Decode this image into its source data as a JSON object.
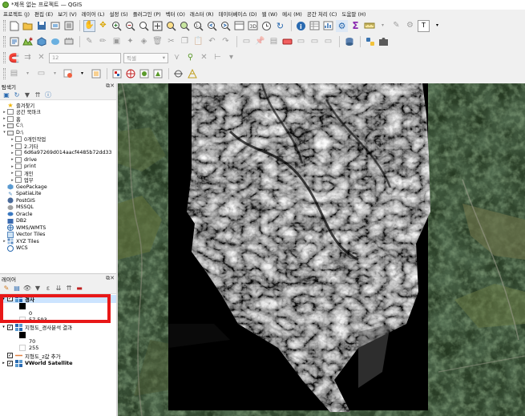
{
  "window": {
    "title": "*제목 없는 프로젝트 — QGIS"
  },
  "menu": [
    "프로젝트 (J)",
    "편집 (E)",
    "보기 (V)",
    "레이어 (L)",
    "설정 (S)",
    "플러그인 (P)",
    "벡터 (O)",
    "래스터 (R)",
    "데이터베이스 (D)",
    "웹 (W)",
    "메시 (M)",
    "공간 처리 (C)",
    "도움말 (H)"
  ],
  "toolbar_digitize": {
    "size_value": "12",
    "unit_value": "픽셀"
  },
  "browser_panel": {
    "title": "탐색기",
    "items": [
      {
        "label": "즐겨찾기",
        "icon": "star-icon",
        "indent": 0,
        "arrow": ""
      },
      {
        "label": "공간 북마크",
        "icon": "bookmark-icon",
        "indent": 0,
        "arrow": "▸"
      },
      {
        "label": "홈",
        "icon": "home-folder-icon",
        "indent": 0,
        "arrow": "▸"
      },
      {
        "label": "C:\\",
        "icon": "drive-icon",
        "indent": 0,
        "arrow": "▸"
      },
      {
        "label": "D:\\",
        "icon": "drive-icon",
        "indent": 0,
        "arrow": "▾"
      },
      {
        "label": "0개인작업",
        "icon": "folder-icon",
        "indent": 1,
        "arrow": "▸"
      },
      {
        "label": "2.기타",
        "icon": "folder-icon",
        "indent": 1,
        "arrow": "▸"
      },
      {
        "label": "6d6a97269d014aacf4485b72dd33",
        "icon": "folder-icon",
        "indent": 1,
        "arrow": "▸"
      },
      {
        "label": "drive",
        "icon": "folder-icon",
        "indent": 1,
        "arrow": "▸"
      },
      {
        "label": "print",
        "icon": "folder-icon",
        "indent": 1,
        "arrow": "▸"
      },
      {
        "label": "개인",
        "icon": "folder-icon",
        "indent": 1,
        "arrow": "▸"
      },
      {
        "label": "업무",
        "icon": "folder-icon",
        "indent": 1,
        "arrow": "▸"
      },
      {
        "label": "GeoPackage",
        "icon": "geopackage-icon",
        "indent": 0,
        "arrow": ""
      },
      {
        "label": "SpatiaLite",
        "icon": "spatialite-icon",
        "indent": 0,
        "arrow": ""
      },
      {
        "label": "PostGIS",
        "icon": "postgis-icon",
        "indent": 0,
        "arrow": ""
      },
      {
        "label": "MSSQL",
        "icon": "mssql-icon",
        "indent": 0,
        "arrow": ""
      },
      {
        "label": "Oracle",
        "icon": "oracle-icon",
        "indent": 0,
        "arrow": ""
      },
      {
        "label": "DB2",
        "icon": "db2-icon",
        "indent": 0,
        "arrow": ""
      },
      {
        "label": "WMS/WMTS",
        "icon": "wms-icon",
        "indent": 0,
        "arrow": ""
      },
      {
        "label": "Vector Tiles",
        "icon": "vector-tiles-icon",
        "indent": 0,
        "arrow": ""
      },
      {
        "label": "XYZ Tiles",
        "icon": "xyz-tiles-icon",
        "indent": 0,
        "arrow": "▸"
      },
      {
        "label": "WCS",
        "icon": "wcs-icon",
        "indent": 0,
        "arrow": ""
      }
    ]
  },
  "layers_panel": {
    "title": "레이어",
    "layers": [
      {
        "name": "경사",
        "min_label": "0",
        "max_label": "57.593"
      },
      {
        "name": "지형도_경사분석 결과",
        "min_label": "70",
        "max_label": "255"
      },
      {
        "name": "지형도_z값 추가"
      },
      {
        "name": "VWorld Satellite"
      }
    ]
  },
  "colors": {
    "highlight": "#e81818",
    "selection": "#cce4ff"
  }
}
